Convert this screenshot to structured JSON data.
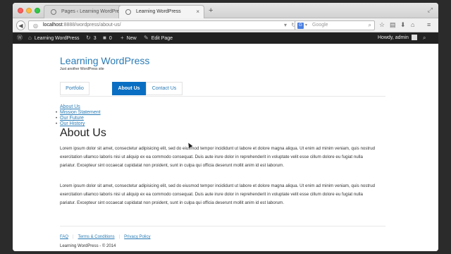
{
  "browser": {
    "tabs": [
      {
        "label": "Pages ‹ Learning WordPress"
      },
      {
        "label": "Learning WordPress"
      }
    ],
    "url_host": "localhost",
    "url_path": ":8888/wordpress/about-us/",
    "search_placeholder": "Google",
    "search_engine_letter": "G"
  },
  "adminbar": {
    "site_name": "Learning WordPress",
    "updates_count": "3",
    "comments_count": "0",
    "new_label": "New",
    "edit_label": "Edit Page",
    "greeting": "Howdy, admin"
  },
  "site": {
    "title": "Learning WordPress",
    "description": "Just another WordPress site"
  },
  "menu": {
    "items": [
      {
        "label": "Portfolio"
      },
      {
        "label": "About Us"
      },
      {
        "label": "Contact Us"
      }
    ]
  },
  "submenu": {
    "items": [
      {
        "label": "About Us"
      },
      {
        "label": "Mission Statement"
      },
      {
        "label": "Our Future"
      },
      {
        "label": "Our History"
      }
    ]
  },
  "page": {
    "title": "About Us",
    "paragraphs": [
      "Lorem ipsum dolor sit amet, consectetur adipisicing elit, sed do eiusmod tempor incididunt ut labore et dolore magna aliqua. Ut enim ad minim veniam, quis nostrud exercitation ullamco laboris nisi ut aliquip ex ea commodo consequat. Duis aute irure dolor in reprehenderit in voluptate velit esse cillum dolore eu fugiat nulla pariatur. Excepteur sint occaecat cupidatat non proident, sunt in culpa qui officia deserunt mollit anim id est laborum.",
      "Lorem ipsum dolor sit amet, consectetur adipisicing elit, sed do eiusmod tempor incididunt ut labore et dolore magna aliqua. Ut enim ad minim veniam, quis nostrud exercitation ullamco laboris nisi ut aliquip ex ea commodo consequat. Duis aute irure dolor in reprehenderit in voluptate velit esse cillum dolore eu fugiat nulla pariatur. Excepteur sint occaecat cupidatat non proident, sunt in culpa qui officia deserunt mollit anim id est laborum."
    ]
  },
  "footer": {
    "links": [
      {
        "label": "FAQ"
      },
      {
        "label": "Terms & Conditions"
      },
      {
        "label": "Privacy Policy"
      }
    ],
    "copyright": "Learning WordPress - © 2014"
  },
  "colors": {
    "link": "#2a7bb5",
    "active_menu": "#0a6fc2",
    "admin_bar": "#222222"
  }
}
